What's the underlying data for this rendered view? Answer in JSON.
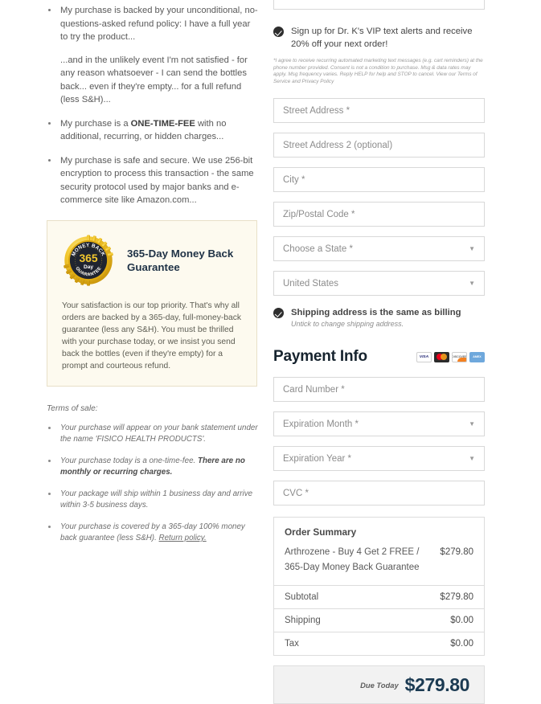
{
  "left": {
    "bullets": [
      {
        "text": "My purchase is backed by your unconditional, no-questions-asked refund policy: I have a full year to try the product...",
        "sub": "...and in the unlikely event I'm not satisfied - for any reason whatsoever - I can send the bottles back... even if they're empty... for a full refund (less S&H)..."
      },
      {
        "pre": "My purchase is a ",
        "strong": "ONE-TIME-FEE",
        "post": " with no additional, recurring, or hidden charges..."
      },
      {
        "text": "My purchase is safe and secure. We use 256-bit encryption to process this transaction - the same security protocol used by major banks and e-commerce site like Amazon.com..."
      }
    ],
    "guarantee": {
      "seal_top": "MONEY BACK",
      "seal_number": "365",
      "seal_day": "Day",
      "seal_bottom": "GUARANTEE",
      "title": "365-Day Money Back Guarantee",
      "body": "Your satisfaction is our top priority. That's why all orders are backed by a 365-day, full-money-back guarantee (less any S&H). You must be thrilled with your purchase today, or we insist you send back the bottles (even if they're empty) for a prompt and courteous refund."
    },
    "terms_label": "Terms of sale:",
    "terms": [
      {
        "pre": "Your purchase will appear on your bank statement under the name 'FISICO HEALTH PRODUCTS'."
      },
      {
        "pre": "Your purchase today is a one-time-fee. ",
        "strong": "There are no monthly or recurring charges."
      },
      {
        "pre": "Your package will ship within 1 business day and arrive within 3-5 business days."
      },
      {
        "pre": "Your purchase is covered by a 365-day 100% money back guarantee (less S&H). ",
        "link": "Return policy."
      }
    ]
  },
  "right": {
    "sms": {
      "label": "Sign up for Dr. K's VIP text alerts and receive 20% off your next order!",
      "legal": "*I agree to receive recurring automated marketing text messages (e.g. cart reminders) at the phone number provided. Consent is not a condition to purchase. Msg & data rates may apply. Msg frequency varies. Reply HELP for help and STOP to cancel. View our Terms of Service and Privacy Policy"
    },
    "address": {
      "street": {
        "placeholder": "Street Address *",
        "value": ""
      },
      "street2": {
        "placeholder": "Street Address 2 (optional)",
        "value": ""
      },
      "city": {
        "placeholder": "City *",
        "value": ""
      },
      "zip": {
        "placeholder": "Zip/Postal Code *",
        "value": ""
      },
      "state": {
        "value": "Choose a State *"
      },
      "country": {
        "value": "United States"
      }
    },
    "shipping_same": {
      "label": "Shipping address is the same as billing",
      "sub": "Untick to change shipping address."
    },
    "payment": {
      "title": "Payment Info",
      "cards": [
        {
          "name": "visa-card-icon",
          "label": "VISA"
        },
        {
          "name": "mastercard-card-icon",
          "label": ""
        },
        {
          "name": "discover-card-icon",
          "label": "DISCOVER"
        },
        {
          "name": "amex-card-icon",
          "label": "AMEX"
        }
      ],
      "card_number": {
        "placeholder": "Card Number *",
        "value": ""
      },
      "exp_month": {
        "value": "Expiration Month *"
      },
      "exp_year": {
        "value": "Expiration Year *"
      },
      "cvc": {
        "placeholder": "CVC *",
        "value": ""
      }
    },
    "summary": {
      "title": "Order Summary",
      "item_name": "Arthrozene - Buy 4 Get 2 FREE / 365-Day Money Back Guarantee",
      "item_price": "$279.80",
      "rows": [
        {
          "label": "Subtotal",
          "value": "$279.80"
        },
        {
          "label": "Shipping",
          "value": "$0.00"
        },
        {
          "label": "Tax",
          "value": "$0.00"
        }
      ]
    },
    "due": {
      "label": "Due Today",
      "amount": "$279.80"
    }
  },
  "colors": {
    "accent_navy": "#1b3a52",
    "seal_gold": "#f0c419",
    "guarantee_bg": "#fdfaef"
  }
}
